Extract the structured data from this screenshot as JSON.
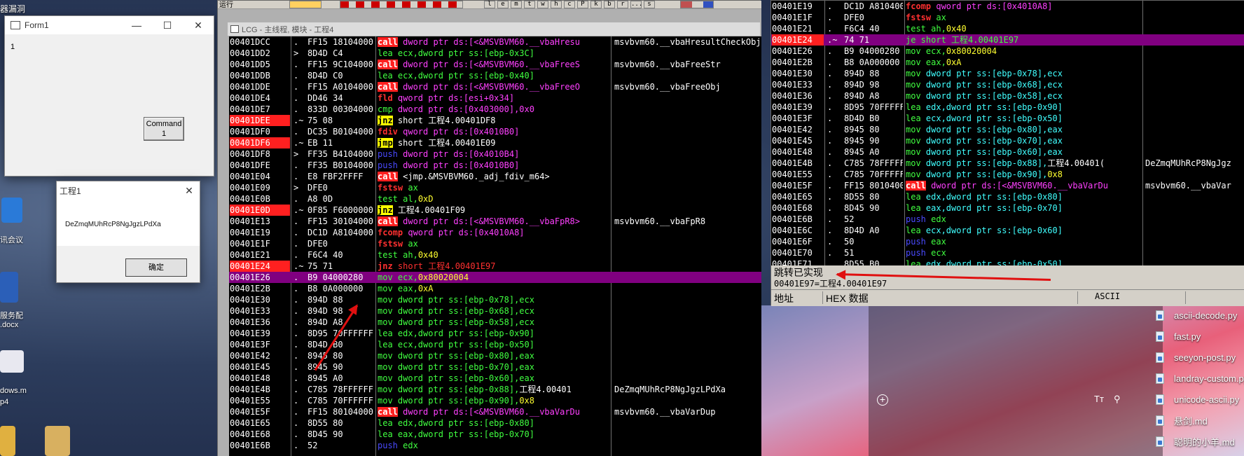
{
  "desktop": {
    "top_label": "器漏洞",
    "meeting_label": "讯会议",
    "doc_label_1": "服务配",
    "doc_label_2": ".docx",
    "video_label_1": "dows.m",
    "video_label_2": "p4"
  },
  "form1": {
    "title": "Form1",
    "content_text": "1",
    "command_label_1": "Command",
    "command_label_2": "1",
    "min_icon": "—",
    "max_icon": "☐",
    "close_icon": "✕"
  },
  "msgbox": {
    "title": "工程1",
    "message": "DeZmqMUhRcP8NgJgzLPdXa",
    "ok_label": "确定",
    "close_icon": "✕"
  },
  "debugger": {
    "menu_fragment": "运行",
    "mdi_title": "LCG - 主线程, 模块 - 工程4",
    "toolbar_letters": [
      "l",
      "e",
      "m",
      "t",
      "w",
      "h",
      "c",
      "P",
      "k",
      "b",
      "r",
      "...",
      "s"
    ],
    "rows": [
      {
        "addr": "00401DCC",
        "mark": ".",
        "hex": "FF15 18104000",
        "mn": "call",
        "mnc": "call",
        "ops": [
          {
            "t": " dword ptr ds:[<&MSVBVM60.__vbaHresu",
            "c": "mem"
          }
        ],
        "cmt": "msvbvm60.__vbaHresultCheckObj"
      },
      {
        "addr": "00401DD2",
        "mark": ">",
        "hex": "8D4D C4",
        "mn": "lea",
        "mnc": "op-gr",
        "ops": [
          {
            "t": " ecx,dword ptr ss:[ebp-0x3C]",
            "c": "gr"
          }
        ],
        "cmt": ""
      },
      {
        "addr": "00401DD5",
        "mark": ".",
        "hex": "FF15 9C104000",
        "mn": "call",
        "mnc": "call",
        "ops": [
          {
            "t": " dword ptr ds:[<&MSVBVM60.__vbaFreeS",
            "c": "mem"
          }
        ],
        "cmt": "msvbvm60.__vbaFreeStr"
      },
      {
        "addr": "00401DDB",
        "mark": ".",
        "hex": "8D4D C0",
        "mn": "lea",
        "mnc": "op-gr",
        "ops": [
          {
            "t": " ecx,dword ptr ss:[ebp-0x40]",
            "c": "gr"
          }
        ],
        "cmt": ""
      },
      {
        "addr": "00401DDE",
        "mark": ".",
        "hex": "FF15 A0104000",
        "mn": "call",
        "mnc": "call",
        "ops": [
          {
            "t": " dword ptr ds:[<&MSVBVM60.__vbaFreeO",
            "c": "mem"
          }
        ],
        "cmt": "msvbvm60.__vbaFreeObj"
      },
      {
        "addr": "00401DE4",
        "mark": ".",
        "hex": "DD46 34",
        "mn": "fld",
        "mnc": "mn-jmp2",
        "ops": [
          {
            "t": " qword ptr ds:[esi+0x34]",
            "c": "mem"
          }
        ],
        "cmt": ""
      },
      {
        "addr": "00401DE7",
        "mark": ".",
        "hex": "833D 00304000",
        "mn": "cmp",
        "mnc": "op-gr",
        "ops": [
          {
            "t": " dword ptr ds:[0x403000],0x0",
            "c": "mem"
          }
        ],
        "cmt": ""
      },
      {
        "addr": "00401DEE",
        "addrRed": true,
        "mark": ".~",
        "hex": "75 08",
        "mn": "jnz",
        "mnc": "jcc",
        "ops": [
          {
            "t": " short 工程4.00401DF8",
            "c": "wh"
          }
        ],
        "cmt": ""
      },
      {
        "addr": "00401DF0",
        "mark": ".",
        "hex": "DC35 B0104000",
        "mn": "fdiv",
        "mnc": "mn-jmp2",
        "ops": [
          {
            "t": " qword ptr ds:[0x4010B0]",
            "c": "mem"
          }
        ],
        "cmt": ""
      },
      {
        "addr": "00401DF6",
        "addrRed": true,
        "mark": ".~",
        "hex": "EB 11",
        "mn": "jmp",
        "mnc": "jcc",
        "ops": [
          {
            "t": " short 工程4.00401E09",
            "c": "wh"
          }
        ],
        "cmt": ""
      },
      {
        "addr": "00401DF8",
        "mark": ">",
        "hex": "FF35 B4104000",
        "mn": "push",
        "mnc": "op-bl",
        "ops": [
          {
            "t": " dword ptr ds:[0x4010B4]",
            "c": "mem"
          }
        ],
        "cmt": ""
      },
      {
        "addr": "00401DFE",
        "mark": ".",
        "hex": "FF35 B0104000",
        "mn": "push",
        "mnc": "op-bl",
        "ops": [
          {
            "t": " dword ptr ds:[0x4010B0]",
            "c": "mem"
          }
        ],
        "cmt": ""
      },
      {
        "addr": "00401E04",
        "mark": ".",
        "hex": "E8 FBF2FFFF",
        "mn": "call",
        "mnc": "call",
        "ops": [
          {
            "t": " <jmp.&MSVBVM60._adj_fdiv_m64>",
            "c": "wh"
          }
        ],
        "cmt": ""
      },
      {
        "addr": "00401E09",
        "mark": ">",
        "hex": "DFE0",
        "mn": "fstsw",
        "mnc": "mn-jmp2",
        "ops": [
          {
            "t": " ax",
            "c": "gr"
          }
        ],
        "cmt": ""
      },
      {
        "addr": "00401E0B",
        "mark": ".",
        "hex": "A8 0D",
        "mn": "test",
        "mnc": "op-gr",
        "ops": [
          {
            "t": " al,",
            "c": "gr"
          },
          {
            "t": "0xD",
            "c": "yel"
          }
        ],
        "cmt": ""
      },
      {
        "addr": "00401E0D",
        "addrRed": true,
        "mark": ".~",
        "hex": "0F85 F6000000",
        "mn": "jnz",
        "mnc": "jcc",
        "ops": [
          {
            "t": " 工程4.00401F09",
            "c": "wh"
          }
        ],
        "cmt": ""
      },
      {
        "addr": "00401E13",
        "mark": ".",
        "hex": "FF15 30104000",
        "mn": "call",
        "mnc": "call",
        "ops": [
          {
            "t": " dword ptr ds:[<&MSVBVM60.__vbaFpR8>",
            "c": "mem"
          }
        ],
        "cmt": "msvbvm60.__vbaFpR8"
      },
      {
        "addr": "00401E19",
        "mark": ".",
        "hex": "DC1D A8104000",
        "mn": "fcomp",
        "mnc": "mn-jmp2",
        "ops": [
          {
            "t": " qword ptr ds:[0x4010A8]",
            "c": "mem"
          }
        ],
        "cmt": ""
      },
      {
        "addr": "00401E1F",
        "mark": ".",
        "hex": "DFE0",
        "mn": "fstsw",
        "mnc": "mn-jmp2",
        "ops": [
          {
            "t": " ax",
            "c": "gr"
          }
        ],
        "cmt": ""
      },
      {
        "addr": "00401E21",
        "mark": ".",
        "hex": "F6C4 40",
        "mn": "test",
        "mnc": "op-gr",
        "ops": [
          {
            "t": " ah,",
            "c": "gr"
          },
          {
            "t": "0x40",
            "c": "yel"
          }
        ],
        "cmt": ""
      },
      {
        "addr": "00401E24",
        "addrRed": true,
        "mark": ".~",
        "hex": "75 71",
        "mn": "jnz",
        "mnc": "mn-jmp2",
        "ops": [
          {
            "t": " short 工程4.00401E97",
            "c": "red"
          }
        ],
        "cmt": ""
      },
      {
        "addr": "00401E26",
        "sel": true,
        "mark": ".",
        "hex": "B9 04000280",
        "mn": "mov",
        "mnc": "op-gr",
        "ops": [
          {
            "t": " ecx,",
            "c": "gr"
          },
          {
            "t": "0x80020004",
            "c": "yel"
          }
        ],
        "cmt": ""
      },
      {
        "addr": "00401E2B",
        "mark": ".",
        "hex": "B8 0A000000",
        "mn": "mov",
        "mnc": "op-gr",
        "ops": [
          {
            "t": " eax,",
            "c": "gr"
          },
          {
            "t": "0xA",
            "c": "yel"
          }
        ],
        "cmt": ""
      },
      {
        "addr": "00401E30",
        "mark": ".",
        "hex": "894D 88",
        "mn": "mov",
        "mnc": "op-gr",
        "ops": [
          {
            "t": " dword ptr ss:[ebp-0x78],ecx",
            "c": "gr"
          }
        ],
        "cmt": ""
      },
      {
        "addr": "00401E33",
        "mark": ".",
        "hex": "894D 98",
        "mn": "mov",
        "mnc": "op-gr",
        "ops": [
          {
            "t": " dword ptr ss:[ebp-0x68],ecx",
            "c": "gr"
          }
        ],
        "cmt": ""
      },
      {
        "addr": "00401E36",
        "mark": ".",
        "hex": "894D A8",
        "mn": "mov",
        "mnc": "op-gr",
        "ops": [
          {
            "t": " dword ptr ss:[ebp-0x58],ecx",
            "c": "gr"
          }
        ],
        "cmt": ""
      },
      {
        "addr": "00401E39",
        "mark": ".",
        "hex": "8D95 70FFFFFF",
        "mn": "lea",
        "mnc": "op-gr",
        "ops": [
          {
            "t": " edx,dword ptr ss:[ebp-0x90]",
            "c": "gr"
          }
        ],
        "cmt": ""
      },
      {
        "addr": "00401E3F",
        "mark": ".",
        "hex": "8D4D B0",
        "mn": "lea",
        "mnc": "op-gr",
        "ops": [
          {
            "t": " ecx,dword ptr ss:[ebp-0x50]",
            "c": "gr"
          }
        ],
        "cmt": ""
      },
      {
        "addr": "00401E42",
        "mark": ".",
        "hex": "8945 80",
        "mn": "mov",
        "mnc": "op-gr",
        "ops": [
          {
            "t": " dword ptr ss:[ebp-0x80],eax",
            "c": "gr"
          }
        ],
        "cmt": ""
      },
      {
        "addr": "00401E45",
        "mark": ".",
        "hex": "8945 90",
        "mn": "mov",
        "mnc": "op-gr",
        "ops": [
          {
            "t": " dword ptr ss:[ebp-0x70],eax",
            "c": "gr"
          }
        ],
        "cmt": ""
      },
      {
        "addr": "00401E48",
        "mark": ".",
        "hex": "8945 A0",
        "mn": "mov",
        "mnc": "op-gr",
        "ops": [
          {
            "t": " dword ptr ss:[ebp-0x60],eax",
            "c": "gr"
          }
        ],
        "cmt": ""
      },
      {
        "addr": "00401E4B",
        "mark": ".",
        "hex": "C785 78FFFFFF",
        "mn": "mov",
        "mnc": "op-gr",
        "ops": [
          {
            "t": " dword ptr ss:[ebp-0x88],",
            "c": "gr"
          },
          {
            "t": "工程4.00401",
            "c": "wh"
          }
        ],
        "cmt": "DeZmqMUhRcP8NgJgzLPdXa"
      },
      {
        "addr": "00401E55",
        "mark": ".",
        "hex": "C785 70FFFFFF",
        "mn": "mov",
        "mnc": "op-gr",
        "ops": [
          {
            "t": " dword ptr ss:[ebp-0x90],",
            "c": "gr"
          },
          {
            "t": "0x8",
            "c": "yel"
          }
        ],
        "cmt": ""
      },
      {
        "addr": "00401E5F",
        "mark": ".",
        "hex": "FF15 80104000",
        "mn": "call",
        "mnc": "call",
        "ops": [
          {
            "t": " dword ptr ds:[<&MSVBVM60.__vbaVarDu",
            "c": "mem"
          }
        ],
        "cmt": "msvbvm60.__vbaVarDup"
      },
      {
        "addr": "00401E65",
        "mark": ".",
        "hex": "8D55 80",
        "mn": "lea",
        "mnc": "op-gr",
        "ops": [
          {
            "t": " edx,dword ptr ss:[ebp-0x80]",
            "c": "gr"
          }
        ],
        "cmt": ""
      },
      {
        "addr": "00401E68",
        "mark": ".",
        "hex": "8D45 90",
        "mn": "lea",
        "mnc": "op-gr",
        "ops": [
          {
            "t": " eax,dword ptr ss:[ebp-0x70]",
            "c": "gr"
          }
        ],
        "cmt": ""
      },
      {
        "addr": "00401E6B",
        "mark": ".",
        "hex": "52",
        "mn": "push",
        "mnc": "op-bl",
        "ops": [
          {
            "t": " edx",
            "c": "gr"
          }
        ],
        "cmt": ""
      }
    ]
  },
  "debugger2": {
    "status": "跳转已实现",
    "target": "00401E97=工程4.00401E97",
    "dump_header": [
      "地址",
      "HEX 数据",
      "ASCII"
    ],
    "rows": [
      {
        "addr": "00401E19",
        "mark": ".",
        "hex": "DC1D A8104000",
        "mn": "fcomp",
        "mnc": "mn-jmp2",
        "ops": [
          {
            "t": " qword ptr ds:[0x4010A8]",
            "c": "mem"
          }
        ],
        "cmt": ""
      },
      {
        "addr": "00401E1F",
        "mark": ".",
        "hex": "DFE0",
        "mn": "fstsw",
        "mnc": "mn-jmp2",
        "ops": [
          {
            "t": " ax",
            "c": "gr"
          }
        ],
        "cmt": ""
      },
      {
        "addr": "00401E21",
        "mark": ".",
        "hex": "F6C4 40",
        "mn": "test",
        "mnc": "op-gr",
        "ops": [
          {
            "t": " ah,",
            "c": "gr"
          },
          {
            "t": "0x40",
            "c": "yel"
          }
        ],
        "cmt": ""
      },
      {
        "addr": "00401E24",
        "sel": true,
        "addrRed": true,
        "mark": ".~",
        "hex": "74 71",
        "mn": "je",
        "mnc": "op-gr",
        "ops": [
          {
            "t": " short 工程4.00401E97",
            "c": "gr"
          }
        ],
        "cmt": ""
      },
      {
        "addr": "00401E26",
        "mark": ".",
        "hex": "B9 04000280",
        "mn": "mov",
        "mnc": "op-gr",
        "ops": [
          {
            "t": " ecx,",
            "c": "gr"
          },
          {
            "t": "0x80020004",
            "c": "yel"
          }
        ],
        "cmt": ""
      },
      {
        "addr": "00401E2B",
        "mark": ".",
        "hex": "B8 0A000000",
        "mn": "mov",
        "mnc": "op-gr",
        "ops": [
          {
            "t": " eax,",
            "c": "gr"
          },
          {
            "t": "0xA",
            "c": "yel"
          }
        ],
        "cmt": ""
      },
      {
        "addr": "00401E30",
        "mark": ".",
        "hex": "894D 88",
        "mn": "mov",
        "mnc": "op-gr",
        "ops": [
          {
            "t": " dword ptr ss:[ebp-0x78],ecx",
            "c": "cy"
          }
        ],
        "cmt": ""
      },
      {
        "addr": "00401E33",
        "mark": ".",
        "hex": "894D 98",
        "mn": "mov",
        "mnc": "op-gr",
        "ops": [
          {
            "t": " dword ptr ss:[ebp-0x68],ecx",
            "c": "cy"
          }
        ],
        "cmt": ""
      },
      {
        "addr": "00401E36",
        "mark": ".",
        "hex": "894D A8",
        "mn": "mov",
        "mnc": "op-gr",
        "ops": [
          {
            "t": " dword ptr ss:[ebp-0x58],ecx",
            "c": "cy"
          }
        ],
        "cmt": ""
      },
      {
        "addr": "00401E39",
        "mark": ".",
        "hex": "8D95 70FFFFFF",
        "mn": "lea",
        "mnc": "op-gr",
        "ops": [
          {
            "t": " edx,dword ptr ss:[ebp-0x90]",
            "c": "cy"
          }
        ],
        "cmt": ""
      },
      {
        "addr": "00401E3F",
        "mark": ".",
        "hex": "8D4D B0",
        "mn": "lea",
        "mnc": "op-gr",
        "ops": [
          {
            "t": " ecx,dword ptr ss:[ebp-0x50]",
            "c": "cy"
          }
        ],
        "cmt": ""
      },
      {
        "addr": "00401E42",
        "mark": ".",
        "hex": "8945 80",
        "mn": "mov",
        "mnc": "op-gr",
        "ops": [
          {
            "t": " dword ptr ss:[ebp-0x80],eax",
            "c": "cy"
          }
        ],
        "cmt": ""
      },
      {
        "addr": "00401E45",
        "mark": ".",
        "hex": "8945 90",
        "mn": "mov",
        "mnc": "op-gr",
        "ops": [
          {
            "t": " dword ptr ss:[ebp-0x70],eax",
            "c": "cy"
          }
        ],
        "cmt": ""
      },
      {
        "addr": "00401E48",
        "mark": ".",
        "hex": "8945 A0",
        "mn": "mov",
        "mnc": "op-gr",
        "ops": [
          {
            "t": " dword ptr ss:[ebp-0x60],eax",
            "c": "cy"
          }
        ],
        "cmt": ""
      },
      {
        "addr": "00401E4B",
        "mark": ".",
        "hex": "C785 78FFFFFF",
        "mn": "mov",
        "mnc": "op-gr",
        "ops": [
          {
            "t": " dword ptr ss:[ebp-0x88],",
            "c": "cy"
          },
          {
            "t": "工程4.00401(",
            "c": "wh"
          }
        ],
        "cmt": "DeZmqMUhRcP8NgJgz"
      },
      {
        "addr": "00401E55",
        "mark": ".",
        "hex": "C785 70FFFFFF",
        "mn": "mov",
        "mnc": "op-gr",
        "ops": [
          {
            "t": " dword ptr ss:[ebp-0x90],",
            "c": "cy"
          },
          {
            "t": "0x8",
            "c": "yel"
          }
        ],
        "cmt": ""
      },
      {
        "addr": "00401E5F",
        "mark": ".",
        "hex": "FF15 80104000",
        "mn": "call",
        "mnc": "call",
        "ops": [
          {
            "t": " dword ptr ds:[<&MSVBVM60.__vbaVarDu",
            "c": "mem"
          }
        ],
        "cmt": "msvbvm60.__vbaVar"
      },
      {
        "addr": "00401E65",
        "mark": ".",
        "hex": "8D55 80",
        "mn": "lea",
        "mnc": "op-gr",
        "ops": [
          {
            "t": " edx,dword ptr ss:[ebp-0x80]",
            "c": "cy"
          }
        ],
        "cmt": ""
      },
      {
        "addr": "00401E68",
        "mark": ".",
        "hex": "8D45 90",
        "mn": "lea",
        "mnc": "op-gr",
        "ops": [
          {
            "t": " eax,dword ptr ss:[ebp-0x70]",
            "c": "cy"
          }
        ],
        "cmt": ""
      },
      {
        "addr": "00401E6B",
        "mark": ".",
        "hex": "52",
        "mn": "push",
        "mnc": "op-bl",
        "ops": [
          {
            "t": " edx",
            "c": "gr"
          }
        ],
        "cmt": ""
      },
      {
        "addr": "00401E6C",
        "mark": ".",
        "hex": "8D4D A0",
        "mn": "lea",
        "mnc": "op-gr",
        "ops": [
          {
            "t": " ecx,dword ptr ss:[ebp-0x60]",
            "c": "cy"
          }
        ],
        "cmt": ""
      },
      {
        "addr": "00401E6F",
        "mark": ".",
        "hex": "50",
        "mn": "push",
        "mnc": "op-bl",
        "ops": [
          {
            "t": " eax",
            "c": "gr"
          }
        ],
        "cmt": ""
      },
      {
        "addr": "00401E70",
        "mark": ".",
        "hex": "51",
        "mn": "push",
        "mnc": "op-bl",
        "ops": [
          {
            "t": " ecx",
            "c": "gr"
          }
        ],
        "cmt": ""
      },
      {
        "addr": "00401E71",
        "mark": ".",
        "hex": "8D55 B0",
        "mn": "lea",
        "mnc": "op-gr",
        "ops": [
          {
            "t": " edx,dword ptr ss:[ebp-0x50]",
            "c": "cy"
          }
        ],
        "cmt": ""
      }
    ]
  },
  "explorer_files": [
    "ascii-decode.py",
    "fast.py",
    "seeyon-post.py",
    "landray-custom.py",
    "unicode-ascii.py",
    "悬剑.md",
    "聪明的小羊.md"
  ],
  "colors": {
    "selected_row": "#800080",
    "addr_red": "#ff2020",
    "arrow": "#e01010"
  }
}
